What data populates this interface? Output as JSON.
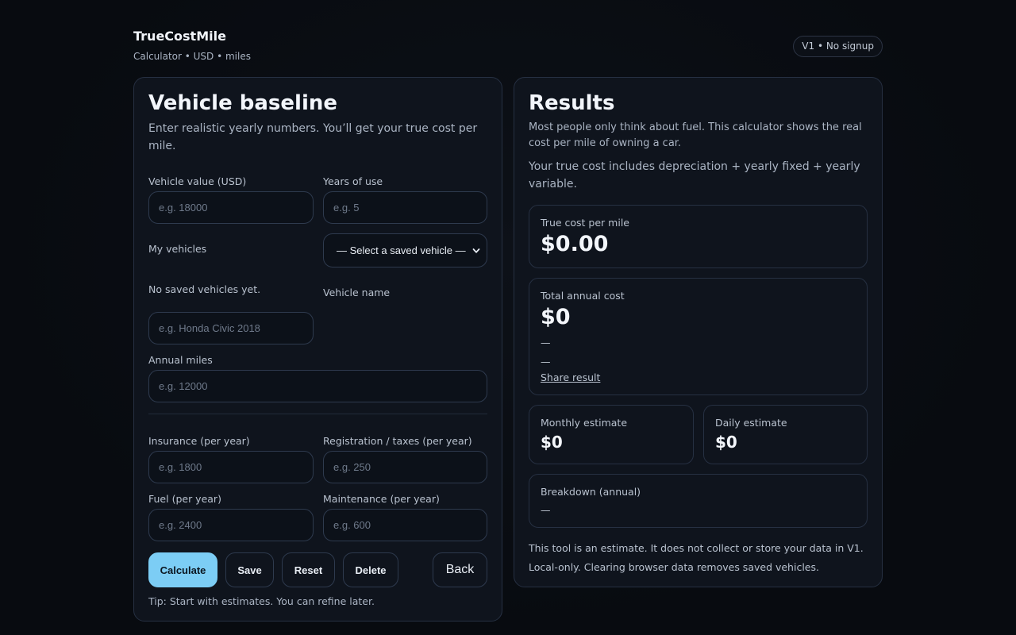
{
  "header": {
    "brand": "TrueCostMile",
    "subtitle": "Calculator • USD • miles",
    "badge": "V1 • No signup"
  },
  "form": {
    "title": "Vehicle baseline",
    "description": "Enter realistic yearly numbers. You’ll get your true cost per mile.",
    "vehicle_value": {
      "label": "Vehicle value (USD)",
      "placeholder": "e.g. 18000",
      "value": ""
    },
    "years_of_use": {
      "label": "Years of use",
      "placeholder": "e.g. 5",
      "value": ""
    },
    "my_vehicles": {
      "label": "My vehicles",
      "selected": "— Select a saved vehicle —",
      "empty_text": "No saved vehicles yet."
    },
    "vehicle_name": {
      "label": "Vehicle name",
      "placeholder": "e.g. Honda Civic 2018",
      "value": ""
    },
    "annual_miles": {
      "label": "Annual miles",
      "placeholder": "e.g. 12000",
      "value": ""
    },
    "insurance": {
      "label": "Insurance (per year)",
      "placeholder": "e.g. 1800",
      "value": ""
    },
    "registration": {
      "label": "Registration / taxes (per year)",
      "placeholder": "e.g. 250",
      "value": ""
    },
    "fuel": {
      "label": "Fuel (per year)",
      "placeholder": "e.g. 2400",
      "value": ""
    },
    "maintenance": {
      "label": "Maintenance (per year)",
      "placeholder": "e.g. 600",
      "value": ""
    },
    "buttons": {
      "calculate": "Calculate",
      "save": "Save",
      "reset": "Reset",
      "delete": "Delete",
      "back": "Back"
    },
    "tip": "Tip: Start with estimates. You can refine later."
  },
  "results": {
    "title": "Results",
    "intro": "Most people only think about fuel. This calculator shows the real cost per mile of owning a car.",
    "explanation": "Your true cost includes depreciation + yearly fixed + yearly variable.",
    "cost_per_mile": {
      "label": "True cost per mile",
      "value": "$0.00"
    },
    "annual_cost": {
      "label": "Total annual cost",
      "value": "$0",
      "line1": "—",
      "line2": "—",
      "share": "Share result"
    },
    "monthly": {
      "label": "Monthly estimate",
      "value": "$0"
    },
    "daily": {
      "label": "Daily estimate",
      "value": "$0"
    },
    "breakdown": {
      "label": "Breakdown (annual)",
      "value": "—"
    },
    "footer1": "This tool is an estimate. It does not collect or store your data in V1.",
    "footer2": "Local-only. Clearing browser data removes saved vehicles."
  },
  "colors": {
    "accent": "#7ccdf5",
    "background": "#090c12",
    "card": "#0f141d",
    "border": "#263042"
  }
}
